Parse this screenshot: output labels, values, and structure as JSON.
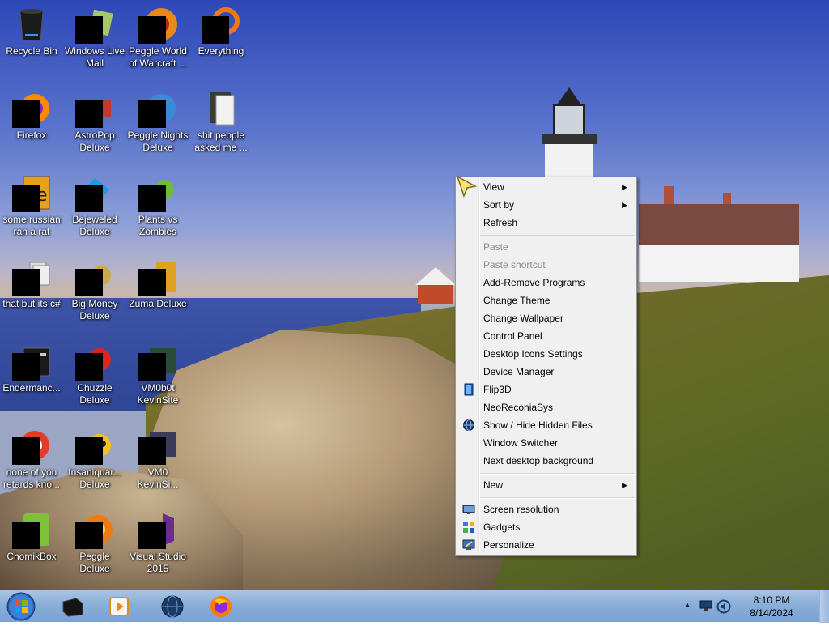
{
  "desktop": {
    "icons": [
      {
        "label": "Recycle Bin",
        "icon": "recycle-bin-icon"
      },
      {
        "label": "Windows Live Mail",
        "icon": "mail-icon"
      },
      {
        "label": "Peggle World of Warcraft ...",
        "icon": "game-icon"
      },
      {
        "label": "Everything",
        "icon": "search-app-icon"
      },
      {
        "label": "Firefox",
        "icon": "firefox-icon"
      },
      {
        "label": "AstroPop Deluxe",
        "icon": "game-icon"
      },
      {
        "label": "Peggle Nights Deluxe",
        "icon": "game-icon"
      },
      {
        "label": "shit people asked me ...",
        "icon": "folder-icon"
      },
      {
        "label": "some russian ran a rat",
        "icon": "file-icon"
      },
      {
        "label": "Bejeweled Deluxe",
        "icon": "game-icon"
      },
      {
        "label": "Plants vs Zombies",
        "icon": "game-icon"
      },
      {
        "label": "that but its c#",
        "icon": "file-icon"
      },
      {
        "label": "Big Money Deluxe",
        "icon": "game-icon"
      },
      {
        "label": "Zuma Deluxe",
        "icon": "game-icon"
      },
      {
        "label": "Endermanc...",
        "icon": "file-icon"
      },
      {
        "label": "Chuzzle Deluxe",
        "icon": "game-icon"
      },
      {
        "label": "VM0b0t KevinSite",
        "icon": "shortcut-icon"
      },
      {
        "label": "none of you retards kno...",
        "icon": "file-icon"
      },
      {
        "label": "Insaniquar... Deluxe",
        "icon": "game-icon"
      },
      {
        "label": "VM0 KevinSi...",
        "icon": "shortcut-icon"
      },
      {
        "label": "ChomikBox",
        "icon": "app-icon"
      },
      {
        "label": "Peggle Deluxe",
        "icon": "game-icon"
      },
      {
        "label": "Visual Studio 2015",
        "icon": "visual-studio-icon"
      }
    ]
  },
  "context_menu": {
    "items": [
      {
        "label": "View",
        "submenu": true
      },
      {
        "label": "Sort by",
        "submenu": true
      },
      {
        "label": "Refresh"
      },
      {
        "label": "Paste",
        "disabled": true
      },
      {
        "label": "Paste shortcut",
        "disabled": true
      },
      {
        "label": "Add-Remove Programs"
      },
      {
        "label": "Change Theme"
      },
      {
        "label": "Change Wallpaper"
      },
      {
        "label": "Control Panel"
      },
      {
        "label": "Desktop Icons Settings"
      },
      {
        "label": "Device Manager"
      },
      {
        "label": "Flip3D",
        "icon": "flip3d-icon"
      },
      {
        "label": "NeoReconiaSys"
      },
      {
        "label": "Show / Hide Hidden Files",
        "icon": "globe-icon"
      },
      {
        "label": "Window Switcher"
      },
      {
        "label": "Next desktop background"
      },
      {
        "label": "New",
        "submenu": true
      },
      {
        "label": "Screen resolution",
        "icon": "monitor-icon"
      },
      {
        "label": "Gadgets",
        "icon": "gadgets-icon"
      },
      {
        "label": "Personalize",
        "icon": "personalize-icon"
      }
    ]
  },
  "taskbar": {
    "pinned": [
      {
        "name": "vm-app",
        "icon": "black-box-icon"
      },
      {
        "name": "media-player",
        "icon": "media-player-icon"
      },
      {
        "name": "browser-globe",
        "icon": "globe-icon"
      },
      {
        "name": "firefox",
        "icon": "firefox-icon"
      }
    ],
    "tray": {
      "time": "8:10 PM",
      "date": "8/14/2024"
    }
  },
  "colors": {
    "taskbar": "#89aed8",
    "menu_bg": "#f0f0f0",
    "menu_disabled": "#8d8d8d"
  }
}
